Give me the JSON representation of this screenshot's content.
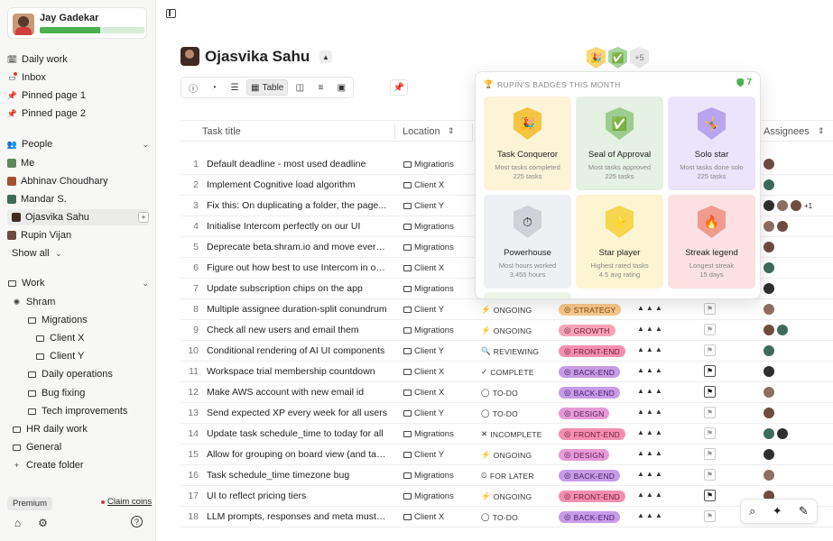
{
  "sidebar": {
    "user": {
      "name": "Jay Gadekar",
      "xp_progress": 0.58
    },
    "nav": [
      {
        "label": "Daily work",
        "icon": "calendar-clock-icon"
      },
      {
        "label": "Inbox",
        "icon": "inbox-icon"
      },
      {
        "label": "Pinned page 1",
        "icon": "pin-icon"
      },
      {
        "label": "Pinned page 2",
        "icon": "pin-icon"
      }
    ],
    "people_header": "People",
    "people": [
      "Me",
      "Abhinav Choudhary",
      "Mandar S.",
      "Ojasvika Sahu",
      "Rupin Vijan"
    ],
    "show_all": "Show all",
    "work_header": "Work",
    "work_tree": [
      {
        "label": "Shram",
        "level": 0
      },
      {
        "label": "Migrations",
        "level": 1
      },
      {
        "label": "Client X",
        "level": 2
      },
      {
        "label": "Client Y",
        "level": 2
      },
      {
        "label": "Daily operations",
        "level": 1
      },
      {
        "label": "Bug fixing",
        "level": 1
      },
      {
        "label": "Tech improvements",
        "level": 1
      }
    ],
    "hr_daily_work": "HR daily work",
    "general": "General",
    "create_folder": "Create folder",
    "premium": "Premium",
    "claim_coins": "Claim coins"
  },
  "page": {
    "title": "Ojasvika Sahu",
    "badge_more": "+5",
    "view_table": "Table"
  },
  "table": {
    "columns": {
      "title": "Task title",
      "location": "Location",
      "assignees": "Assignees"
    },
    "rows": [
      {
        "n": "1",
        "title": "Default deadline - most used deadline",
        "loc": "Migrations",
        "status": "",
        "tag": "",
        "av": 1
      },
      {
        "n": "2",
        "title": "Implement Cognitive load algorithm",
        "loc": "Client X",
        "status": "",
        "tag": "",
        "av": 1
      },
      {
        "n": "3",
        "title": "Fix this: On duplicating a folder, the page...",
        "loc": "Client Y",
        "status": "",
        "tag": "",
        "av": 3,
        "more": "+1"
      },
      {
        "n": "4",
        "title": "Initialise Intercom perfectly on our UI",
        "loc": "Migrations",
        "status": "",
        "tag": "",
        "av": 2
      },
      {
        "n": "5",
        "title": "Deprecate beta.shram.io and move everything...",
        "loc": "Migrations",
        "status": "",
        "tag": "",
        "av": 1
      },
      {
        "n": "6",
        "title": "Figure out how best to use Intercom in our app",
        "loc": "Client X",
        "status": "",
        "tag": "",
        "av": 1
      },
      {
        "n": "7",
        "title": "Update subscription chips on the app",
        "loc": "Migrations",
        "status": "",
        "tag": "",
        "av": 1
      },
      {
        "n": "8",
        "title": "Multiple assignee duration-split conundrum",
        "loc": "Client Y",
        "status": "ONGOING",
        "tag": "STRATEGY",
        "av": 1
      },
      {
        "n": "9",
        "title": "Check all new users and email them",
        "loc": "Migrations",
        "status": "ONGOING",
        "tag": "GROWTH",
        "av": 2
      },
      {
        "n": "10",
        "title": "Conditional rendering of AI UI components",
        "loc": "Client Y",
        "status": "REVIEWING",
        "tag": "FRONT-END",
        "av": 1
      },
      {
        "n": "11",
        "title": "Workspace trial membership countdown",
        "loc": "Client X",
        "status": "COMPLETE",
        "tag": "BACK-END",
        "av": 1,
        "flag": true
      },
      {
        "n": "12",
        "title": "Make AWS account with new email id",
        "loc": "Client X",
        "status": "TO-DO",
        "tag": "BACK-END",
        "av": 1,
        "flag": true
      },
      {
        "n": "13",
        "title": "Send expected XP every week for all users",
        "loc": "Client Y",
        "status": "TO-DO",
        "tag": "DESIGN",
        "av": 1
      },
      {
        "n": "14",
        "title": "Update task schedule_time to today for all",
        "loc": "Migrations",
        "status": "INCOMPLETE",
        "tag": "FRONT-END",
        "av": 2
      },
      {
        "n": "15",
        "title": "Allow for grouping on board view (and table)",
        "loc": "Client Y",
        "status": "ONGOING",
        "tag": "DESIGN",
        "av": 1
      },
      {
        "n": "16",
        "title": "Task schedule_time timezone bug",
        "loc": "Migrations",
        "status": "FOR LATER",
        "tag": "BACK-END",
        "av": 1
      },
      {
        "n": "17",
        "title": "UI to reflect pricing tiers",
        "loc": "Migrations",
        "status": "ONGOING",
        "tag": "FRONT-END",
        "av": 1,
        "flag": true
      },
      {
        "n": "18",
        "title": "LLM prompts, responses and meta must be stored",
        "loc": "Client X",
        "status": "TO-DO",
        "tag": "BACK-END",
        "av": 1
      }
    ]
  },
  "popover": {
    "title": "RUPIN'S BADGES THIS MONTH",
    "count": "7",
    "badges": [
      {
        "name": "Task Conqueror",
        "desc1": "Most tasks completed",
        "desc2": "225 tasks",
        "bg": "#fdf3d7",
        "shield": "#f5c542",
        "icon": "🎉"
      },
      {
        "name": "Seal of Approval",
        "desc1": "Most tasks approved",
        "desc2": "225 tasks",
        "bg": "#e5f1e2",
        "shield": "#9ccc8e",
        "icon": "✅"
      },
      {
        "name": "Solo star",
        "desc1": "Most tasks done solo",
        "desc2": "225 tasks",
        "bg": "#ebe4fb",
        "shield": "#b9a4ef",
        "icon": "🤸"
      },
      {
        "name": "Powerhouse",
        "desc1": "Most hours worked",
        "desc2": "3,455 hours",
        "bg": "#eef0f3",
        "shield": "#cfd3d9",
        "icon": "⏱"
      },
      {
        "name": "Star player",
        "desc1": "Highest rated tasks",
        "desc2": "4.5 avg rating",
        "bg": "#fdf5d2",
        "shield": "#f6d54f",
        "icon": "⭐"
      },
      {
        "name": "Streak legend",
        "desc1": "Longest streak",
        "desc2": "15 days",
        "bg": "#fbe1e1",
        "shield": "#f19b8f",
        "icon": "🔥"
      }
    ]
  },
  "colors": {
    "accent": "#4caf50",
    "tag_text": "#6b2d5c"
  }
}
